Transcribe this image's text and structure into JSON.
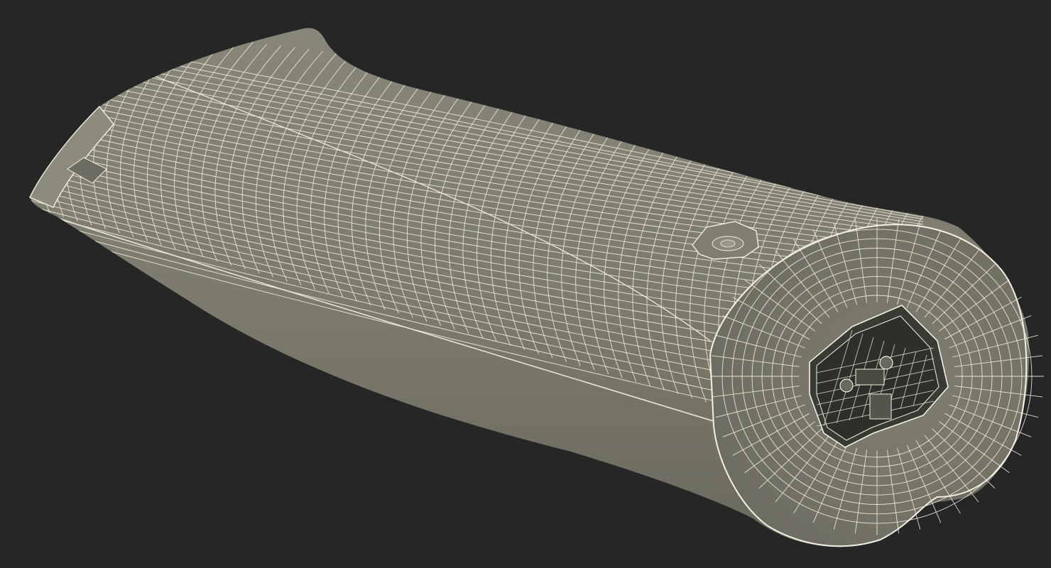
{
  "scene": {
    "subject": "wireframe-power-adapter-model",
    "colors": {
      "background": "#262626",
      "surface": "#7c7b6d",
      "surface_shadow": "#5e5d52",
      "wire": "#f4f1e0",
      "socket_dark": "#2e2e2a",
      "socket_mid": "#4a4a43"
    },
    "wireframe_visible": true
  }
}
